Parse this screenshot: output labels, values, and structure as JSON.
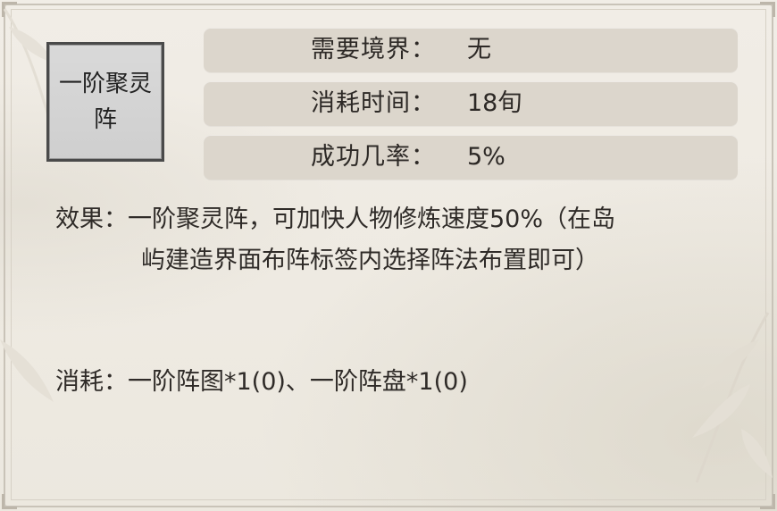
{
  "formation": {
    "name": "一阶聚灵阵"
  },
  "requirements": [
    {
      "label": "需要境界：",
      "value": "无"
    },
    {
      "label": "消耗时间：",
      "value": "18旬"
    },
    {
      "label": "成功几率：",
      "value": "5%"
    }
  ],
  "effect": {
    "prefix": "效果：",
    "line1": "一阶聚灵阵，可加快人物修炼速度50%（在岛",
    "line2": "屿建造界面布阵标签内选择阵法布置即可）"
  },
  "consume": {
    "text": "消耗：一阶阵图*1(0)、一阶阵盘*1(0)"
  },
  "colors": {
    "background": "#efebe3",
    "row_bg": "#dcd6cc",
    "box_bg": "#d4d4d4",
    "box_border": "#4a4a4a",
    "text": "#2f2b28"
  }
}
